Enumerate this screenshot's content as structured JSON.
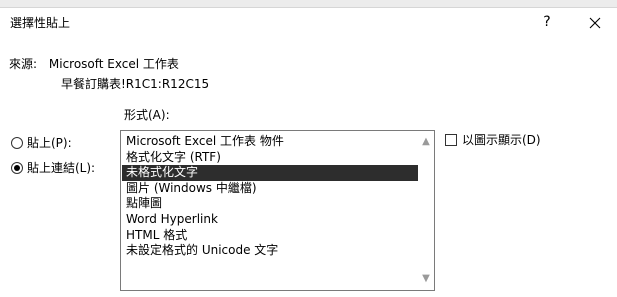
{
  "dialog": {
    "title": "選擇性貼上",
    "help_label": "?",
    "close_icon": "close-icon"
  },
  "source": {
    "label": "來源:",
    "app": "Microsoft Excel 工作表",
    "reference": "早餐訂購表!R1C1:R12C15"
  },
  "format_label": "形式(A):",
  "radios": {
    "paste_label": "貼上(P):",
    "paste_link_label": "貼上連結(L):",
    "selected": "paste_link"
  },
  "formats": [
    "Microsoft Excel 工作表 物件",
    "格式化文字 (RTF)",
    "未格式化文字",
    "圖片 (Windows 中繼檔)",
    "點陣圖",
    "Word Hyperlink",
    "HTML 格式",
    "未設定格式的 Unicode 文字"
  ],
  "selected_format_index": 2,
  "display_as_icon": {
    "label": "以圖示顯示(D)",
    "checked": false
  },
  "scroll": {
    "up_icon": "scroll-up-icon",
    "down_icon": "scroll-down-icon"
  }
}
